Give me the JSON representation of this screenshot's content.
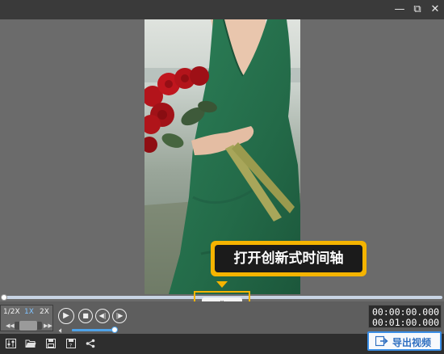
{
  "window": {
    "minimize_glyph": "—",
    "restore_glyph": "⧉",
    "close_glyph": "✕"
  },
  "tooltip": {
    "text": "打开创新式时间轴"
  },
  "timeline_toggle": {
    "chevron": "⌄"
  },
  "playback": {
    "progress": 0.0,
    "speed_options": [
      "1/2X",
      "1X",
      "2X"
    ],
    "active_speed": "1X",
    "volume": 0.95
  },
  "timecode": {
    "current": "00:00:00.000",
    "total": "00:01:00.000"
  },
  "toolbar": {
    "icons": [
      "mixer-icon",
      "folder-open-icon",
      "save-icon",
      "save-as-icon",
      "share-icon"
    ]
  },
  "export": {
    "label": "导出视频"
  },
  "colors": {
    "accent_yellow": "#f5b400",
    "accent_blue": "#3a8ee6",
    "dress_green": "#2f7a56",
    "rose_red": "#b3141b"
  }
}
